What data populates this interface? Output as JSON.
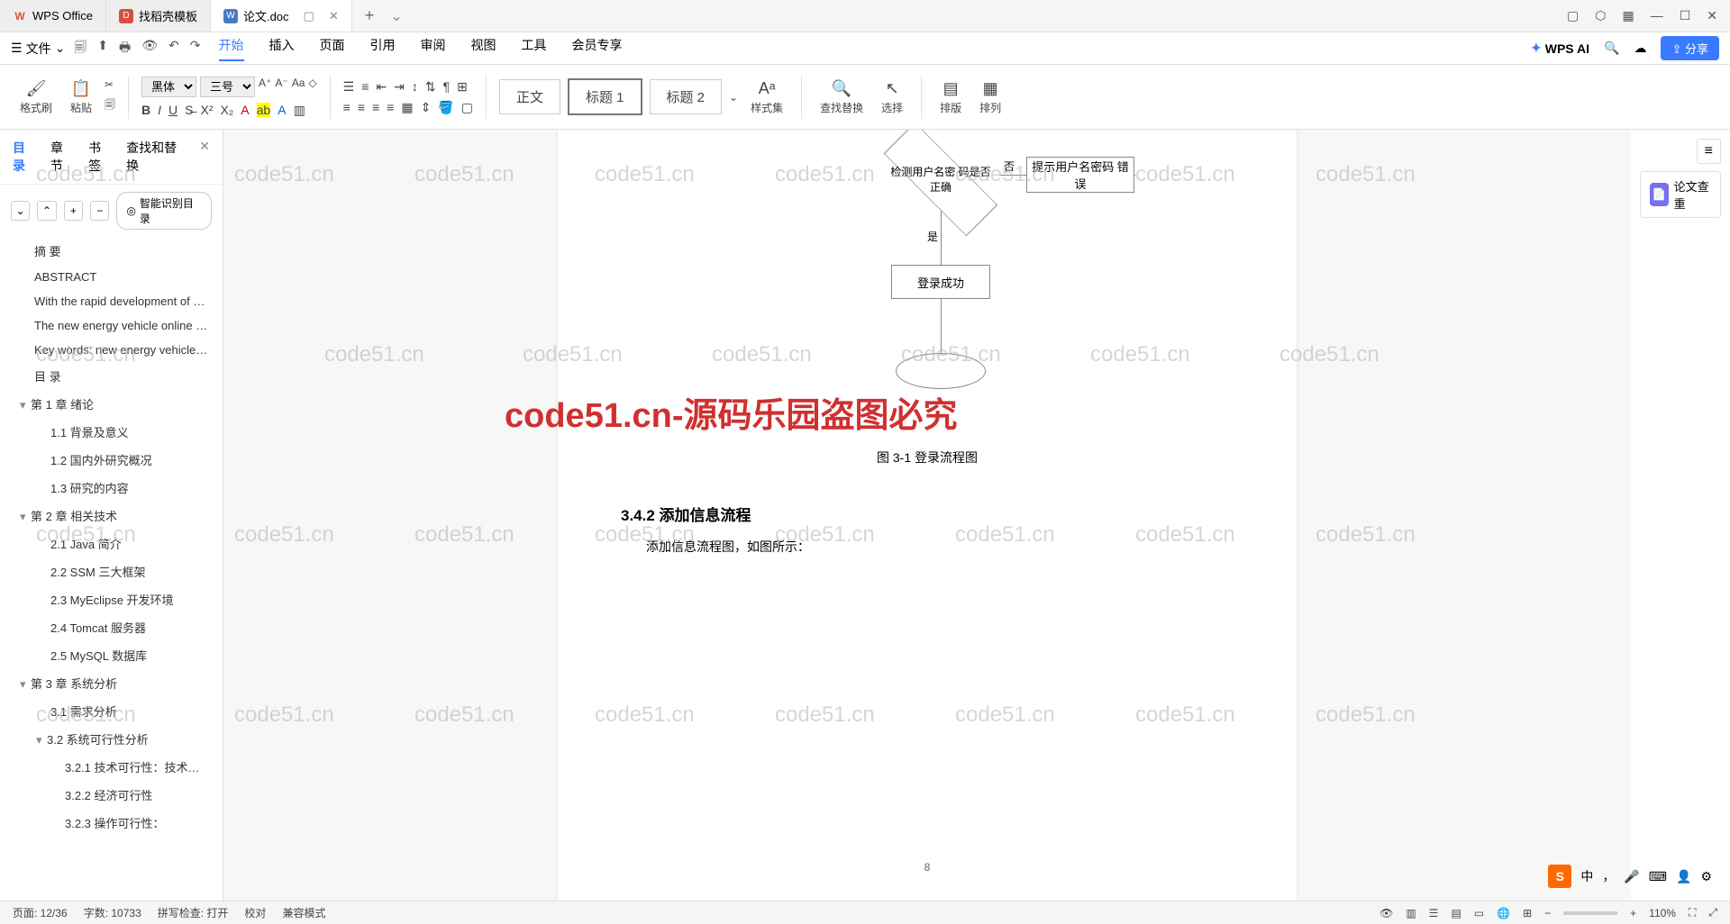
{
  "titlebar": {
    "tabs": [
      {
        "icon": "W",
        "label": "WPS Office"
      },
      {
        "icon": "D",
        "label": "找稻壳模板"
      },
      {
        "icon": "W",
        "label": "论文.doc"
      }
    ]
  },
  "menubar": {
    "file": "文件",
    "items": [
      "开始",
      "插入",
      "页面",
      "引用",
      "审阅",
      "视图",
      "工具",
      "会员专享"
    ],
    "wpsai": "WPS AI",
    "share": "分享"
  },
  "ribbon": {
    "format_brush": "格式刷",
    "paste": "粘贴",
    "font_name": "黑体",
    "font_size": "三号",
    "body_text": "正文",
    "heading1": "标题 1",
    "heading2": "标题 2",
    "styles": "样式集",
    "find_replace": "查找替换",
    "select": "选择",
    "layout": "排版",
    "arrange": "排列"
  },
  "sidebar": {
    "tabs": [
      "目录",
      "章节",
      "书签",
      "查找和替换"
    ],
    "smart_toc": "智能识别目录",
    "toc": [
      {
        "text": "摘  要",
        "lvl": 1
      },
      {
        "text": "ABSTRACT",
        "lvl": 1
      },
      {
        "text": "With the rapid development of s…",
        "lvl": 1
      },
      {
        "text": "The new energy vehicle online re…",
        "lvl": 1
      },
      {
        "text": "Key words: new energy vehicle o…",
        "lvl": 1
      },
      {
        "text": "目 录",
        "lvl": 1
      },
      {
        "text": "第 1 章 绪论",
        "lvl": 1,
        "arrow": true
      },
      {
        "text": "1.1 背景及意义",
        "lvl": 2
      },
      {
        "text": "1.2 国内外研究概况",
        "lvl": 2
      },
      {
        "text": "1.3 研究的内容",
        "lvl": 2
      },
      {
        "text": "第 2 章 相关技术",
        "lvl": 1,
        "arrow": true
      },
      {
        "text": "2.1 Java 简介",
        "lvl": 2
      },
      {
        "text": "2.2 SSM 三大框架",
        "lvl": 2
      },
      {
        "text": "2.3 MyEclipse 开发环境",
        "lvl": 2
      },
      {
        "text": "2.4 Tomcat 服务器",
        "lvl": 2
      },
      {
        "text": "2.5 MySQL 数据库",
        "lvl": 2
      },
      {
        "text": "第 3 章 系统分析",
        "lvl": 1,
        "arrow": true
      },
      {
        "text": "3.1 需求分析",
        "lvl": 2
      },
      {
        "text": "3.2 系统可行性分析",
        "lvl": 2,
        "arrow": true
      },
      {
        "text": "3.2.1 技术可行性：技术背景 …",
        "lvl": 3
      },
      {
        "text": "3.2.2 经济可行性",
        "lvl": 3
      },
      {
        "text": "3.2.3 操作可行性：",
        "lvl": 3
      }
    ]
  },
  "document": {
    "flow_check": "检测用户名密\n码是否正确",
    "flow_error": "提示用户名密码\n错误",
    "flow_no": "否",
    "flow_yes": "是",
    "flow_success": "登录成功",
    "caption": "图 3-1 登录流程图",
    "heading": "3.4.2 添加信息流程",
    "paragraph": "添加信息流程图，如图所示：",
    "page_num": "8"
  },
  "rightpanel": {
    "check_paper": "论文查重"
  },
  "watermark": {
    "text": "code51.cn",
    "big": "code51.cn-源码乐园盗图必究"
  },
  "ime": {
    "mode": "中"
  },
  "statusbar": {
    "page": "页面: 12/36",
    "words": "字数: 10733",
    "spell": "拼写检查: 打开",
    "proof": "校对",
    "compat": "兼容模式",
    "zoom": "110%"
  }
}
